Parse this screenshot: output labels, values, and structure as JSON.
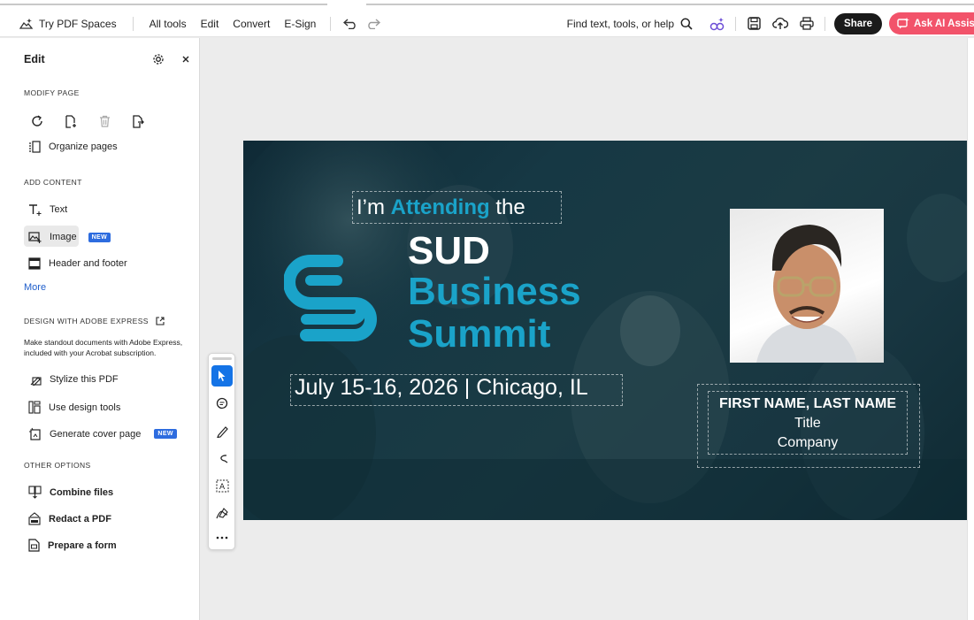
{
  "toolbar": {
    "spaces_label": "Try PDF Spaces",
    "nav": [
      "All tools",
      "Edit",
      "Convert",
      "E-Sign"
    ],
    "find_label": "Find text, tools, or help",
    "share_label": "Share",
    "ai_label": "Ask AI Assistant"
  },
  "panel": {
    "title": "Edit",
    "modify_heading": "MODIFY PAGE",
    "organize_label": "Organize pages",
    "add_heading": "ADD CONTENT",
    "text_label": "Text",
    "image_label": "Image",
    "new_badge": "NEW",
    "header_footer_label": "Header and footer",
    "more_label": "More",
    "design_heading": "DESIGN WITH ADOBE EXPRESS",
    "design_desc": "Make standout documents with Adobe Express, included with your Acrobat subscription.",
    "stylize_label": "Stylize this PDF",
    "design_tools_label": "Use design tools",
    "cover_label": "Generate cover page",
    "other_heading": "OTHER OPTIONS",
    "combine_label": "Combine files",
    "redact_label": "Redact a PDF",
    "form_label": "Prepare a form"
  },
  "slide": {
    "attend_prefix": "I’m",
    "attend_word": "Attending",
    "attend_suffix": "the",
    "line1": "SUD",
    "line2": "Business",
    "line3": "Summit",
    "date": "July 15-16, 2026 | Chicago, IL",
    "name": "FIRST NAME, LAST NAME",
    "title": "Title",
    "company": "Company"
  },
  "colors": {
    "accent_blue": "#1aa3c9",
    "select_blue": "#1473e6",
    "ai_button": "#f2536a"
  }
}
